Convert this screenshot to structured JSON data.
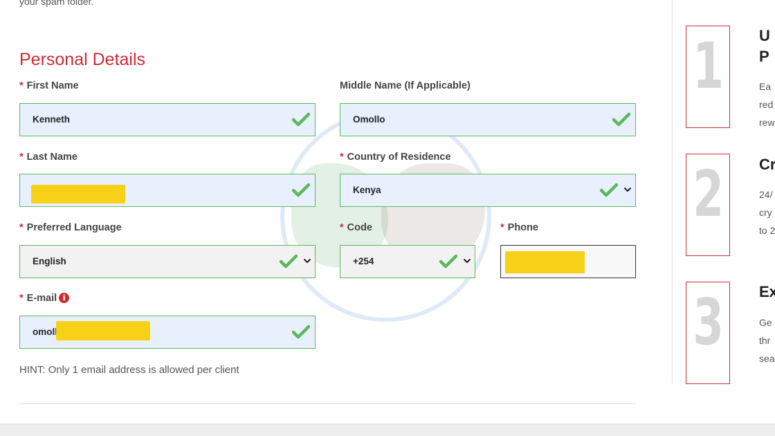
{
  "top_note": "your spam folder.",
  "section_title": "Personal Details",
  "fields": {
    "first_name": {
      "label": "First Name",
      "required": true,
      "value": "Kenneth"
    },
    "middle_name": {
      "label": "Middle Name (If Applicable)",
      "required": false,
      "value": "Omollo"
    },
    "last_name": {
      "label": "Last Name",
      "required": true,
      "value": ""
    },
    "country": {
      "label": "Country of Residence",
      "required": true,
      "value": "Kenya"
    },
    "language": {
      "label": "Preferred Language",
      "required": true,
      "value": "English"
    },
    "code": {
      "label": "Code",
      "required": true,
      "value": "+254"
    },
    "phone": {
      "label": "Phone",
      "required": true,
      "value": ""
    },
    "email": {
      "label": "E-mail",
      "required": true,
      "value": "omoll"
    }
  },
  "required_marker": "*",
  "hint": "HINT: Only 1 email address is allowed per client",
  "steps": [
    {
      "number": "1",
      "title_line1": "U",
      "title_line2": "P",
      "text": [
        "Ea",
        "red",
        "rew"
      ]
    },
    {
      "number": "2",
      "title_line1": "Cr",
      "title_line2": "",
      "text": [
        "24/",
        "cry",
        "to 2"
      ]
    },
    {
      "number": "3",
      "title_line1": "Ex",
      "title_line2": "",
      "text": [
        "Ge",
        "thr",
        "sea"
      ]
    }
  ],
  "colors": {
    "accent": "#cc2b33",
    "valid": "#5cb85c",
    "autofill_bg": "#e8f0fe",
    "redaction": "#f7d117"
  },
  "icons": {
    "valid": "check-icon",
    "dropdown": "chevron-down-icon",
    "info": "info-icon"
  }
}
